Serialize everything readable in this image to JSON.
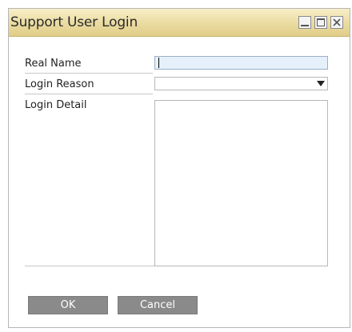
{
  "window": {
    "title": "Support User Login"
  },
  "form": {
    "real_name_label": "Real Name",
    "real_name_value": "",
    "login_reason_label": "Login Reason",
    "login_reason_value": "",
    "login_detail_label": "Login Detail",
    "login_detail_value": ""
  },
  "buttons": {
    "ok_label": "OK",
    "cancel_label": "Cancel"
  },
  "icons": {
    "minimize": "minimize-icon",
    "maximize": "maximize-icon",
    "close": "close-icon",
    "dropdown": "chevron-down-icon"
  },
  "colors": {
    "titlebar": "#eadba0",
    "button": "#8a8a8a",
    "active_input": "#e6f0fa"
  }
}
